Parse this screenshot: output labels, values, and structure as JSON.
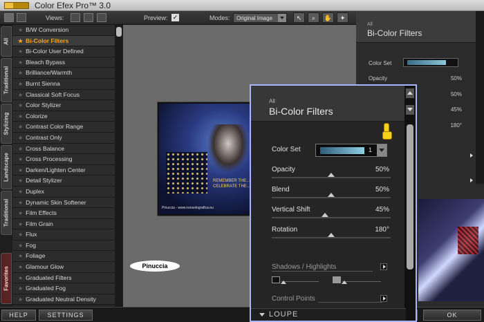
{
  "app": {
    "title": "Color Efex Pro™ 3.0"
  },
  "toolbar": {
    "views_label": "Views:",
    "preview_label": "Preview:",
    "preview_checked": true,
    "modes_label": "Modes:",
    "mode_value": "Original Image",
    "tools": [
      "pointer-icon",
      "zoom-icon",
      "hand-icon",
      "light-icon"
    ]
  },
  "tabs": [
    "All",
    "Traditional",
    "Stylizing",
    "Landscape",
    "Traditional",
    "Favorites"
  ],
  "filters": [
    "B/W Conversion",
    "Bi-Color Filters",
    "Bi-Color User Defined",
    "Bleach Bypass",
    "Brilliance/Warmth",
    "Burnt Sienna",
    "Classical Soft Focus",
    "Color Stylizer",
    "Colorize",
    "Contrast Color Range",
    "Contrast Only",
    "Cross Balance",
    "Cross Processing",
    "Darken/Lighten Center",
    "Detail Stylizer",
    "Duplex",
    "Dynamic Skin Softener",
    "Film Effects",
    "Film Grain",
    "Flux",
    "Fog",
    "Foliage",
    "Glamour Glow",
    "Graduated Filters",
    "Graduated Fog",
    "Graduated Neutral Density"
  ],
  "selected_filter": "Bi-Color Filters",
  "preview": {
    "caption": "REMEMBER THE... CELEBRATE THE...",
    "credit": "Pinuccia - www.nonsolografica.eu",
    "watermark": "Pinuccia"
  },
  "panel": {
    "category": "All",
    "title": "Bi-Color Filters",
    "color_set_label": "Color Set",
    "color_set_value": "1",
    "params": [
      {
        "label": "Opacity",
        "value": "50%",
        "level": 0.5
      },
      {
        "label": "Blend",
        "value": "50%",
        "level": 0.5
      },
      {
        "label": "Vertical Shift",
        "value": "45%",
        "level": 0.45
      },
      {
        "label": "Rotation",
        "value": "180°",
        "level": 0.5
      }
    ],
    "shadows_label": "Shadows / Highlights",
    "control_points_label": "Control Points",
    "loupe_label": "LOUPE"
  },
  "bottom": {
    "help": "HELP",
    "settings": "SETTINGS",
    "ok": "OK"
  }
}
